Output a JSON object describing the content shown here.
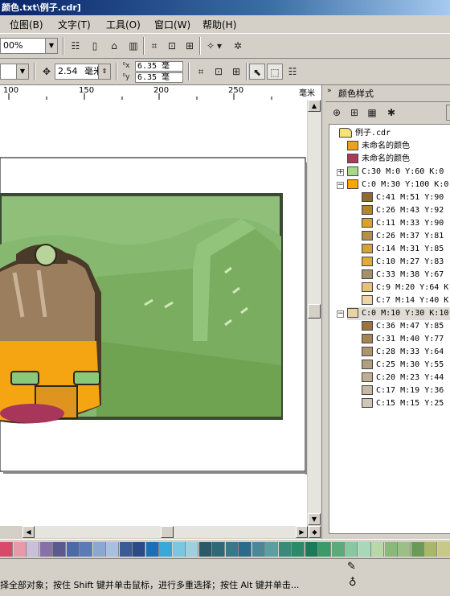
{
  "window": {
    "title": "颜色.txt\\例子.cdr]"
  },
  "menu": [
    {
      "id": "bitmap",
      "label": "位图(B)"
    },
    {
      "id": "text",
      "label": "文字(T)"
    },
    {
      "id": "tools",
      "label": "工具(O)"
    },
    {
      "id": "window",
      "label": "窗口(W)"
    },
    {
      "id": "help",
      "label": "帮助(H)"
    }
  ],
  "toolbar": {
    "zoom": "00%"
  },
  "propbar": {
    "nudge": "2.54",
    "nudge_unit": "毫米",
    "dup_x": "6.35",
    "dup_y": "6.35",
    "dup_x_unit": "毫",
    "dup_y_unit": "毫"
  },
  "ruler": {
    "ticks": [
      "100",
      "150",
      "200",
      "250"
    ],
    "unit": "毫米"
  },
  "docker": {
    "title": "颜色样式",
    "tree": [
      {
        "label": "例子.cdr",
        "type": "folder",
        "color": "#f5e27a",
        "indent": 0
      },
      {
        "label": "未命名的颜色",
        "type": "color",
        "color": "#f0a020",
        "indent": 1
      },
      {
        "label": "未命名的颜色",
        "type": "color",
        "color": "#a83a5a",
        "indent": 1
      },
      {
        "label": "C:30 M:0 Y:60 K:0",
        "type": "parent",
        "color": "#a8d88a",
        "indent": 1,
        "expander": "+"
      },
      {
        "label": "C:0 M:30 Y:100 K:0",
        "type": "parent",
        "color": "#f7a800",
        "indent": 1,
        "expander": "−"
      },
      {
        "label": "C:41 M:51 Y:90",
        "type": "child",
        "color": "#8c6a32",
        "indent": 2
      },
      {
        "label": "C:26 M:43 Y:92",
        "type": "child",
        "color": "#b2862a",
        "indent": 2
      },
      {
        "label": "C:11 M:33 Y:90",
        "type": "child",
        "color": "#d9a22a",
        "indent": 2
      },
      {
        "label": "C:26 M:37 Y:81",
        "type": "child",
        "color": "#b48f45",
        "indent": 2
      },
      {
        "label": "C:14 M:31 Y:85",
        "type": "child",
        "color": "#d4a23c",
        "indent": 2
      },
      {
        "label": "C:10 M:27 Y:83",
        "type": "child",
        "color": "#deab3c",
        "indent": 2
      },
      {
        "label": "C:33 M:38 Y:67",
        "type": "child",
        "color": "#a8906a",
        "indent": 2
      },
      {
        "label": "C:9 M:20 Y:64 K",
        "type": "child",
        "color": "#e6c278",
        "indent": 2
      },
      {
        "label": "C:7 M:14 Y:40 K",
        "type": "child",
        "color": "#ecd6a8",
        "indent": 2
      },
      {
        "label": "C:0 M:10 Y:30 K:10",
        "type": "parent",
        "color": "#e8d2a6",
        "indent": 1,
        "expander": "−",
        "selected": true
      },
      {
        "label": "C:36 M:47 Y:85",
        "type": "child",
        "color": "#9a7340",
        "indent": 2
      },
      {
        "label": "C:31 M:40 Y:77",
        "type": "child",
        "color": "#a68352",
        "indent": 2
      },
      {
        "label": "C:28 M:33 Y:64",
        "type": "child",
        "color": "#ad9570",
        "indent": 2
      },
      {
        "label": "C:25 M:30 Y:55",
        "type": "child",
        "color": "#b49e80",
        "indent": 2
      },
      {
        "label": "C:20 M:23 Y:44",
        "type": "child",
        "color": "#c0ae92",
        "indent": 2
      },
      {
        "label": "C:17 M:19 Y:36",
        "type": "child",
        "color": "#c7b8a2",
        "indent": 2
      },
      {
        "label": "C:15 M:15 Y:25",
        "type": "child",
        "color": "#cfc6b8",
        "indent": 2
      }
    ]
  },
  "palette": [
    "#d94a6a",
    "#e89aa8",
    "#c8c0d8",
    "#8870a8",
    "#5a5a90",
    "#4a6aa8",
    "#5a7ab8",
    "#8aa8d0",
    "#aac0e0",
    "#3a5a98",
    "#2a4a88",
    "#1a70b8",
    "#3aa8d8",
    "#7ac8e0",
    "#a0d0e0",
    "#2a5a6a",
    "#306878",
    "#387888",
    "#2a6a8a",
    "#4a8898",
    "#5aa0a0",
    "#3a8a7a",
    "#2a8a6a",
    "#1a7a5a",
    "#3a9a6a",
    "#5aaa7a",
    "#88c8a0",
    "#a8d8b8",
    "#b8d8a8",
    "#8ab878",
    "#9ac088",
    "#6a9a58",
    "#a8b868",
    "#c8c888"
  ],
  "status": {
    "hint": "择全部对象；按住 Shift 键并单击鼠标，进行多重选择；按住 Alt 键并单击..."
  },
  "colors": {
    "titlebar": "#0a246a",
    "artwork_bg": "#8fbf78",
    "artwork_frame": "#3a4a32"
  }
}
